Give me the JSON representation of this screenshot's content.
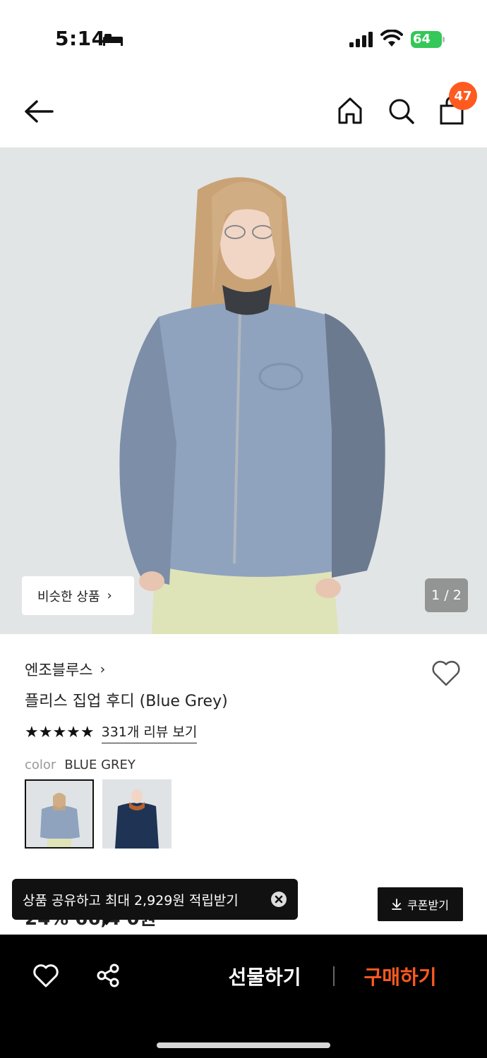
{
  "status_bar": {
    "time": "5:14",
    "battery": "64"
  },
  "header": {
    "cart_count": "47"
  },
  "hero": {
    "similar_label": "비슷한 상품",
    "page_indicator": "1 / 2"
  },
  "product": {
    "brand": "엔조블루스",
    "title": "플리스 집업 후디 (Blue Grey)",
    "stars": "★★★★★",
    "rating": 5,
    "review_link": "331개 리뷰 보기",
    "color_label": "color",
    "color_value": "BLUE GREY",
    "price_peek": "24%  66,4 0원"
  },
  "toast": {
    "text": "상품 공유하고 최대 2,929원 적립받기"
  },
  "coupon": {
    "label": "쿠폰받기"
  },
  "bottom_bar": {
    "gift_label": "선물하기",
    "buy_label": "구매하기"
  },
  "colors": {
    "accent": "#ff5a1f",
    "battery": "#34c759",
    "swatch_blue_grey": "#8fa3bf",
    "swatch_navy": "#1f3354"
  }
}
